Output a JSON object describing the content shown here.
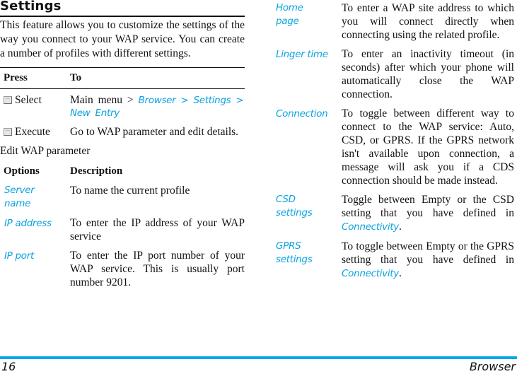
{
  "section": {
    "title": "Settings",
    "intro": "This feature allows you to customize the settings of the way you connect to your WAP service. You can create a number of profiles with different settings."
  },
  "press_table": {
    "headers": [
      "Press",
      "To"
    ],
    "rows": [
      {
        "key_icon": "select-key-icon",
        "key": "Select",
        "action_prefix": "Main menu > ",
        "path": [
          "Browser",
          "Settings",
          "New Entry"
        ],
        "separator": " > "
      },
      {
        "key_icon": "execute-key-icon",
        "key": "Execute",
        "action": "Go to WAP parameter and edit details."
      }
    ]
  },
  "edit_section": {
    "subtitle": "Edit WAP parameter",
    "headers": [
      "Options",
      "Description"
    ],
    "left_rows": [
      {
        "option": "Server name",
        "description": "To name the current profile"
      },
      {
        "option": "IP address",
        "description": "To enter the IP address of your WAP service"
      },
      {
        "option": "IP port",
        "description": "To enter the IP port number of your WAP service. This is usually port number 9201."
      }
    ],
    "right_rows": [
      {
        "option": "Home page",
        "description": "To enter a WAP site address to which you will connect directly when connecting using the related profile."
      },
      {
        "option": "Linger time",
        "description": "To enter an inactivity timeout (in seconds) after which your phone will automatically close the WAP connection."
      },
      {
        "option": "Connection",
        "description": "To toggle between different way to connect to the WAP service: Auto, CSD, or GPRS. If the GPRS network isn't available upon connection, a message will ask you if a CDS connection should be made instead."
      },
      {
        "option": "CSD settings",
        "description_prefix": "Toggle between Empty or the CSD setting that you have defined in ",
        "link": "Connectivity",
        "description_suffix": "."
      },
      {
        "option": "GPRS settings",
        "description_prefix": "To toggle between Empty or the GPRS setting that you have defined in ",
        "link": "Connectivity",
        "description_suffix": "."
      }
    ]
  },
  "footer": {
    "page_number": "16",
    "chapter": "Browser",
    "accent_color": "#00a6e8"
  },
  "colors": {
    "link": "#0aa3e0",
    "text": "#111111"
  }
}
